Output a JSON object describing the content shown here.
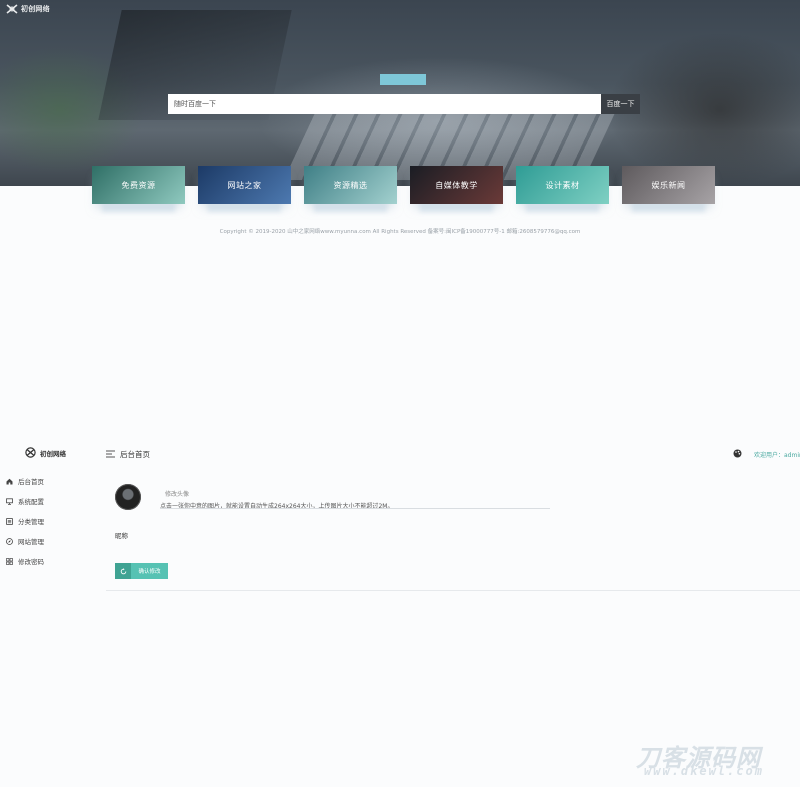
{
  "site": {
    "logo_text": "初创网络"
  },
  "hero": {
    "search_placeholder": "随时百度一下",
    "search_button": "百度一下"
  },
  "categories": [
    {
      "label": "免费资源",
      "color_from": "#2f6f66",
      "color_to": "#8fc9bf"
    },
    {
      "label": "网站之家",
      "color_from": "#1c3a66",
      "color_to": "#4d79b0"
    },
    {
      "label": "资源精选",
      "color_from": "#3f7f86",
      "color_to": "#a3d1cf"
    },
    {
      "label": "自媒体教学",
      "color_from": "#1a1d24",
      "color_to": "#6b3a38"
    },
    {
      "label": "设计素材",
      "color_from": "#2f9c95",
      "color_to": "#7fd0c3"
    },
    {
      "label": "娱乐新闻",
      "color_from": "#5e5a5d",
      "color_to": "#a7a3a6"
    }
  ],
  "footer": {
    "copyright": "Copyright © 2019-2020 山中之家网络www.myunna.com All Rights Reserved 备案号:闽ICP备19000777号-1 邮箱:2608579776@qq.com"
  },
  "admin": {
    "logo_text": "初创网络",
    "header_title": "后台首页",
    "user_label": "欢迎用户：admin",
    "sidebar": [
      {
        "label": "后台首页",
        "icon": "home-icon"
      },
      {
        "label": "系统配置",
        "icon": "monitor-icon"
      },
      {
        "label": "分类管理",
        "icon": "list-icon"
      },
      {
        "label": "网站管理",
        "icon": "compass-icon"
      },
      {
        "label": "修改密码",
        "icon": "grid-icon"
      }
    ],
    "avatar_label": "修改头像",
    "hint": "点击一张你中意的图片，就能设置自动生成264x264大小，上传图片大小不能超过2M。",
    "nickname_label": "昵称",
    "save_button": "确认修改"
  },
  "colors": {
    "accent": "#56c2b3",
    "accent_dark": "#3fa393",
    "search_button_bg": "#3a3f45",
    "hero_accent": "#7ec7d8"
  },
  "watermark": {
    "main": "刀客源码网",
    "sub": "www.dkewl.com"
  }
}
